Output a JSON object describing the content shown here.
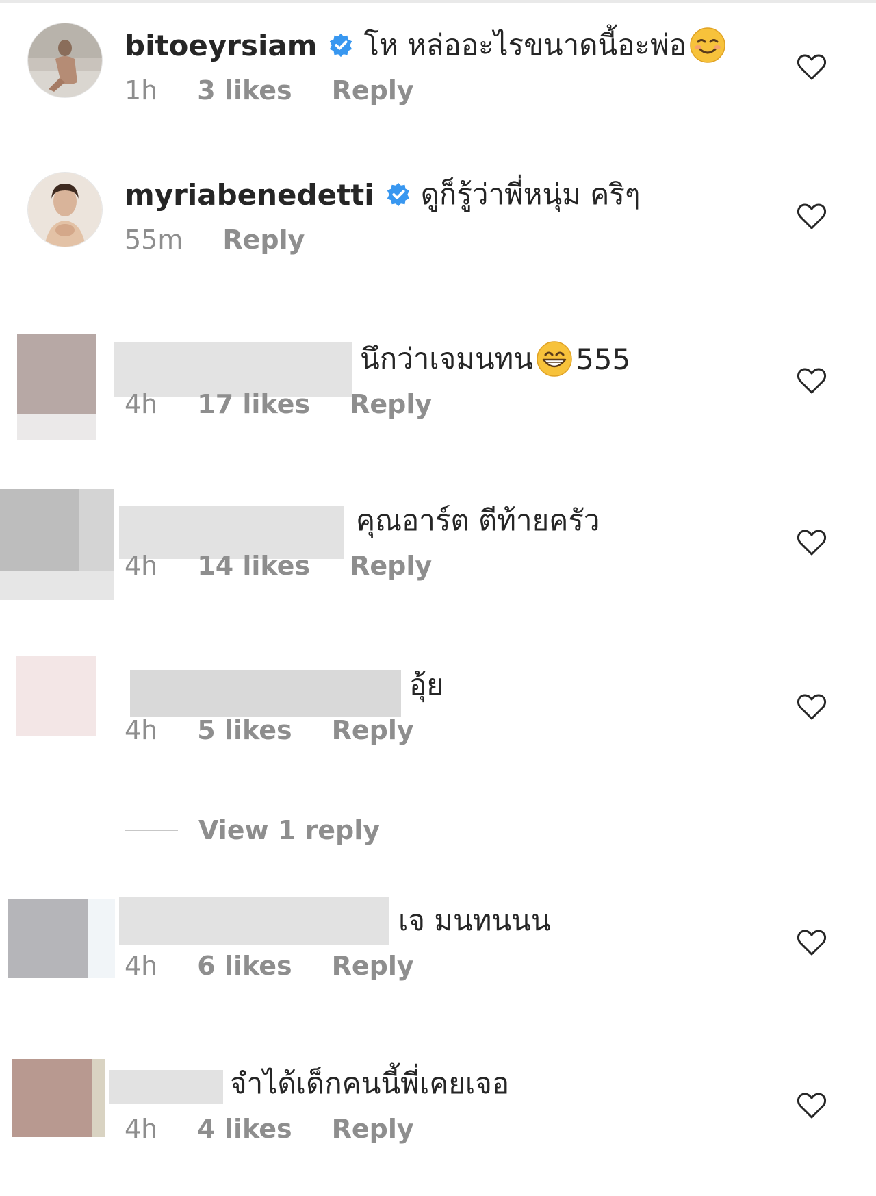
{
  "comments": [
    {
      "username": "bitoeyrsiam",
      "verified": true,
      "text": "โห หล่ออะไรขนาดนี้อะพ่อ",
      "emoji": "relieved-smile-emoji",
      "time": "1h",
      "likes": "3 likes",
      "reply": "Reply"
    },
    {
      "username": "myriabenedetti",
      "verified": true,
      "text": "ดูก็รู้ว่าพี่หนุ่ม คริๆ",
      "time": "55m",
      "reply": "Reply"
    },
    {
      "username": "",
      "text": "นึกว่าเจมนทน",
      "emoji": "grinning-emoji",
      "text_after": "555",
      "time": "4h",
      "likes": "17 likes",
      "reply": "Reply"
    },
    {
      "username": "",
      "text": "คุณอาร์ต ตีท้ายครัว",
      "time": "4h",
      "likes": "14 likes",
      "reply": "Reply"
    },
    {
      "username": "",
      "text": "อุ้ย",
      "time": "4h",
      "likes": "5 likes",
      "reply": "Reply",
      "view_replies": "View 1 reply"
    },
    {
      "username": "",
      "text": "เจ มนทนนน",
      "time": "4h",
      "likes": "6 likes",
      "reply": "Reply"
    },
    {
      "username": "",
      "text": "จำได้เด็กคนนี้พี่เคยเจอ",
      "time": "4h",
      "likes": "4 likes",
      "reply": "Reply"
    }
  ],
  "colors": {
    "secondary_text": "#8e8e8e",
    "primary_text": "#262626",
    "verified_badge": "#3897f0"
  },
  "icons": {
    "like": "heart-outline-icon",
    "verified": "verified-badge-icon"
  }
}
